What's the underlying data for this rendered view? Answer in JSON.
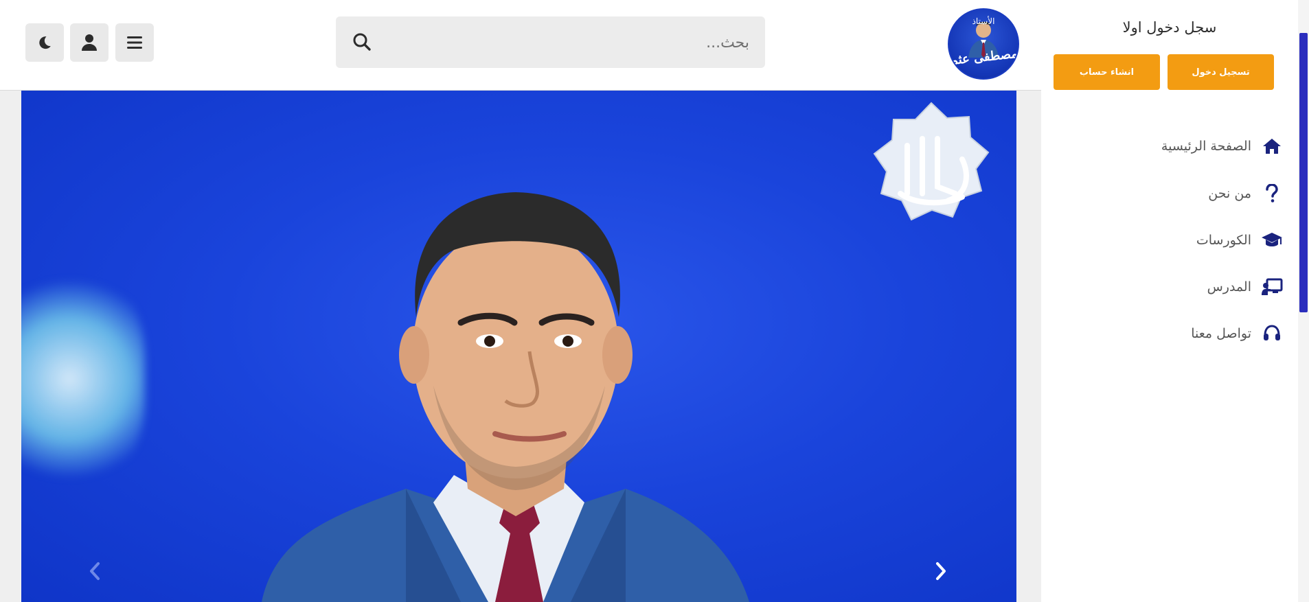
{
  "header": {
    "search": {
      "placeholder": "بحث...",
      "value": ""
    },
    "buttons": [
      {
        "name": "theme-toggle",
        "icon": "moon-icon"
      },
      {
        "name": "account",
        "icon": "user-icon"
      },
      {
        "name": "menu",
        "icon": "hamburger-icon"
      }
    ],
    "logo": {
      "line1": "الأستاذ",
      "line2": "مصطفى عثمان"
    }
  },
  "hero": {
    "prev_icon": "chevron-left-icon",
    "next_icon": "chevron-right-icon"
  },
  "sidebar": {
    "title": "سجل دخول اولا",
    "login_label": "تسجيل دخول",
    "register_label": "انشاء حساب",
    "items": [
      {
        "label": "الصفحة الرئيسية",
        "icon": "home-icon"
      },
      {
        "label": "من نحن",
        "icon": "question-icon"
      },
      {
        "label": "الكورسات",
        "icon": "graduation-cap-icon"
      },
      {
        "label": "المدرس",
        "icon": "teacher-board-icon"
      },
      {
        "label": "تواصل معنا",
        "icon": "headset-icon"
      }
    ]
  },
  "colors": {
    "accent": "#f39c12",
    "brand": "#1a237e",
    "hero_blue": "#1a44db",
    "scroll_thumb": "#2b2ebd"
  }
}
